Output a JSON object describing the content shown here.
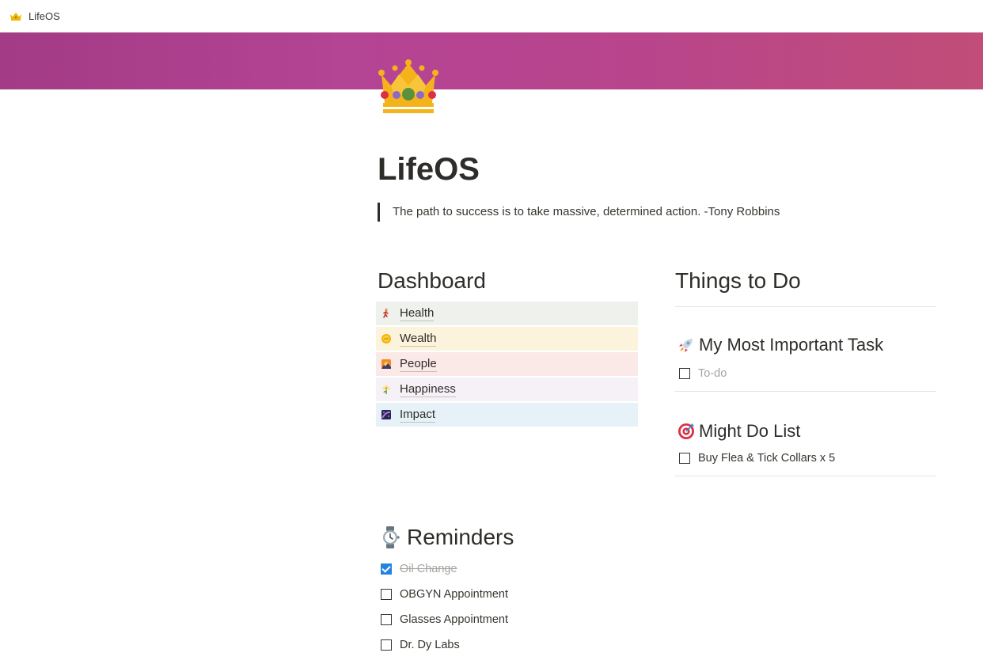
{
  "window": {
    "title": "LifeOS"
  },
  "page": {
    "title": "LifeOS",
    "quote": "The path to success is to take massive, determined action. -Tony Robbins",
    "cover_gradient": [
      "#a33b86",
      "#c14d78"
    ]
  },
  "dashboard": {
    "heading": "Dashboard",
    "items": [
      {
        "label": "Health",
        "icon": "person-running-icon",
        "bg": "#eef1ec"
      },
      {
        "label": "Wealth",
        "icon": "coin-icon",
        "bg": "#fbf3db"
      },
      {
        "label": "People",
        "icon": "sunset-photo-icon",
        "bg": "#fbe9e7"
      },
      {
        "label": "Happiness",
        "icon": "flower-icon",
        "bg": "#f6f1f7"
      },
      {
        "label": "Impact",
        "icon": "galaxy-icon",
        "bg": "#e7f1f8"
      }
    ]
  },
  "things_to_do": {
    "heading": "Things to Do",
    "mit": {
      "heading": "My Most Important Task",
      "icon": "rocket-icon",
      "todo_placeholder": "To-do"
    },
    "might_do": {
      "heading": "Might Do List",
      "icon": "target-icon",
      "items": [
        {
          "text": "Buy Flea & Tick Collars x 5",
          "checked": false
        }
      ]
    }
  },
  "reminders": {
    "heading": "Reminders",
    "icon": "watch-icon",
    "items": [
      {
        "text": "Oil Change",
        "checked": true
      },
      {
        "text": "OBGYN Appointment",
        "checked": false
      },
      {
        "text": "Glasses Appointment",
        "checked": false
      },
      {
        "text": "Dr. Dy Labs",
        "checked": false
      }
    ]
  }
}
